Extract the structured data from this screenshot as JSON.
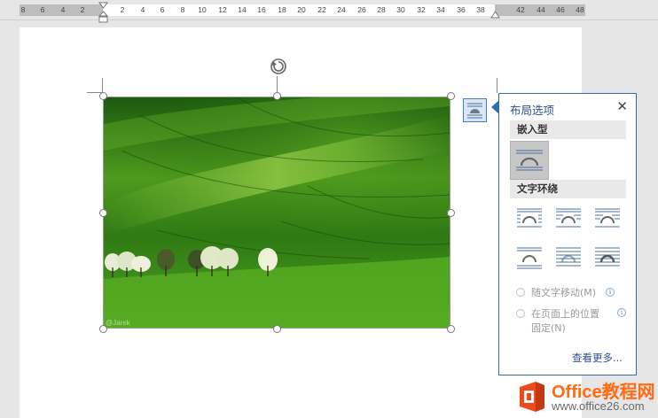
{
  "ruler": {
    "ticks": [
      "8",
      "6",
      "4",
      "2",
      "2",
      "4",
      "6",
      "8",
      "10",
      "12",
      "14",
      "16",
      "18",
      "20",
      "22",
      "24",
      "26",
      "28",
      "30",
      "32",
      "34",
      "36",
      "38",
      "42",
      "44",
      "46",
      "48"
    ]
  },
  "image": {
    "watermark": "@Jarek"
  },
  "layout_panel": {
    "title": "布局选项",
    "close_label": "✕",
    "inline_section": "嵌入型",
    "wrap_section": "文字环绕",
    "move_with_text": "随文字移动(M)",
    "fix_position_line1": "在页面上的位置",
    "fix_position_line2": "固定(N)",
    "info_glyph": "i",
    "see_more": "查看更多...",
    "selected_option": "inline"
  },
  "logo": {
    "brand": "Office教程网",
    "url": "www.office26.com"
  },
  "colors": {
    "accent": "#2e6db3",
    "panel_title": "#2f4f8f",
    "logo_orange": "#ff6a13"
  }
}
